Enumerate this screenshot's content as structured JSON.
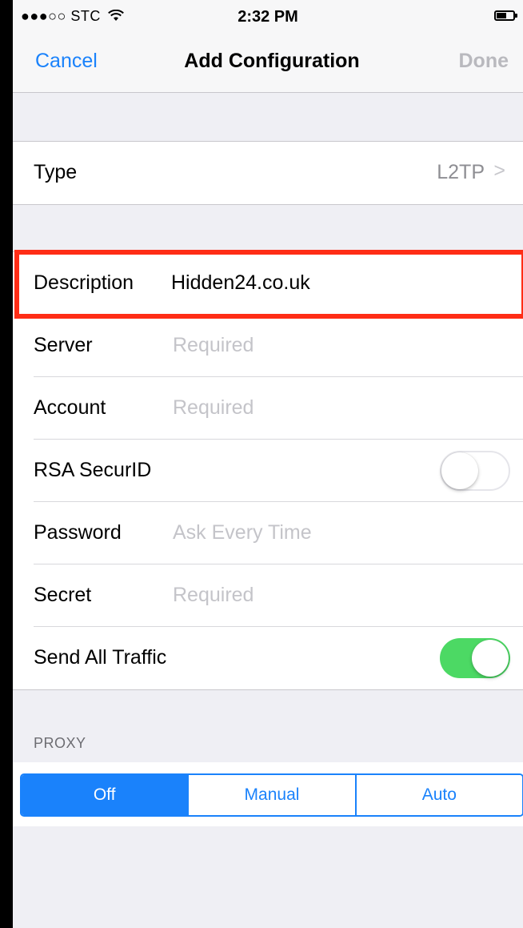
{
  "status_bar": {
    "carrier": "●●●○○ STC",
    "time": "2:32 PM"
  },
  "nav": {
    "cancel_label": "Cancel",
    "title": "Add Configuration",
    "done_label": "Done"
  },
  "type_row": {
    "label": "Type",
    "value": "L2TP"
  },
  "fields": {
    "description": {
      "label": "Description",
      "value": "Hidden24.co.uk"
    },
    "server": {
      "label": "Server",
      "placeholder": "Required"
    },
    "account": {
      "label": "Account",
      "placeholder": "Required"
    },
    "rsa": {
      "label": "RSA SecurID",
      "on": false
    },
    "password": {
      "label": "Password",
      "placeholder": "Ask Every Time"
    },
    "secret": {
      "label": "Secret",
      "placeholder": "Required"
    },
    "send_all": {
      "label": "Send All Traffic",
      "on": true
    }
  },
  "proxy": {
    "header": "PROXY",
    "options": [
      "Off",
      "Manual",
      "Auto"
    ],
    "selected": "Off"
  },
  "colors": {
    "accent": "#1a82fb",
    "toggle_on": "#4cd964",
    "highlight": "#ff2d16"
  },
  "icons": {
    "wifi": "wifi-icon",
    "battery": "battery-icon",
    "chevron": "chevron-right-icon"
  }
}
